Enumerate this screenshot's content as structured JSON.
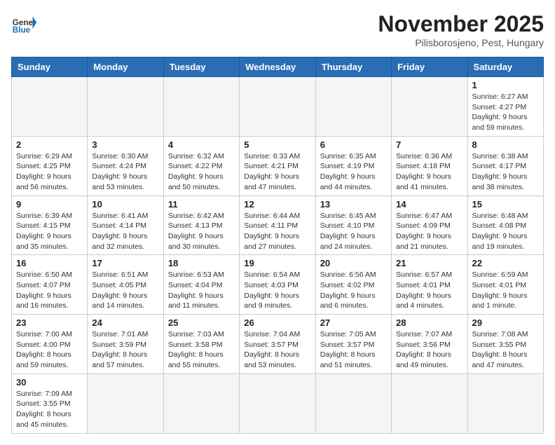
{
  "header": {
    "logo_general": "General",
    "logo_blue": "Blue",
    "month": "November 2025",
    "location": "Pilisborosjeno, Pest, Hungary"
  },
  "weekdays": [
    "Sunday",
    "Monday",
    "Tuesday",
    "Wednesday",
    "Thursday",
    "Friday",
    "Saturday"
  ],
  "weeks": [
    [
      {
        "day": "",
        "info": ""
      },
      {
        "day": "",
        "info": ""
      },
      {
        "day": "",
        "info": ""
      },
      {
        "day": "",
        "info": ""
      },
      {
        "day": "",
        "info": ""
      },
      {
        "day": "",
        "info": ""
      },
      {
        "day": "1",
        "info": "Sunrise: 6:27 AM\nSunset: 4:27 PM\nDaylight: 9 hours\nand 59 minutes."
      }
    ],
    [
      {
        "day": "2",
        "info": "Sunrise: 6:29 AM\nSunset: 4:25 PM\nDaylight: 9 hours\nand 56 minutes."
      },
      {
        "day": "3",
        "info": "Sunrise: 6:30 AM\nSunset: 4:24 PM\nDaylight: 9 hours\nand 53 minutes."
      },
      {
        "day": "4",
        "info": "Sunrise: 6:32 AM\nSunset: 4:22 PM\nDaylight: 9 hours\nand 50 minutes."
      },
      {
        "day": "5",
        "info": "Sunrise: 6:33 AM\nSunset: 4:21 PM\nDaylight: 9 hours\nand 47 minutes."
      },
      {
        "day": "6",
        "info": "Sunrise: 6:35 AM\nSunset: 4:19 PM\nDaylight: 9 hours\nand 44 minutes."
      },
      {
        "day": "7",
        "info": "Sunrise: 6:36 AM\nSunset: 4:18 PM\nDaylight: 9 hours\nand 41 minutes."
      },
      {
        "day": "8",
        "info": "Sunrise: 6:38 AM\nSunset: 4:17 PM\nDaylight: 9 hours\nand 38 minutes."
      }
    ],
    [
      {
        "day": "9",
        "info": "Sunrise: 6:39 AM\nSunset: 4:15 PM\nDaylight: 9 hours\nand 35 minutes."
      },
      {
        "day": "10",
        "info": "Sunrise: 6:41 AM\nSunset: 4:14 PM\nDaylight: 9 hours\nand 32 minutes."
      },
      {
        "day": "11",
        "info": "Sunrise: 6:42 AM\nSunset: 4:13 PM\nDaylight: 9 hours\nand 30 minutes."
      },
      {
        "day": "12",
        "info": "Sunrise: 6:44 AM\nSunset: 4:11 PM\nDaylight: 9 hours\nand 27 minutes."
      },
      {
        "day": "13",
        "info": "Sunrise: 6:45 AM\nSunset: 4:10 PM\nDaylight: 9 hours\nand 24 minutes."
      },
      {
        "day": "14",
        "info": "Sunrise: 6:47 AM\nSunset: 4:09 PM\nDaylight: 9 hours\nand 21 minutes."
      },
      {
        "day": "15",
        "info": "Sunrise: 6:48 AM\nSunset: 4:08 PM\nDaylight: 9 hours\nand 19 minutes."
      }
    ],
    [
      {
        "day": "16",
        "info": "Sunrise: 6:50 AM\nSunset: 4:07 PM\nDaylight: 9 hours\nand 16 minutes."
      },
      {
        "day": "17",
        "info": "Sunrise: 6:51 AM\nSunset: 4:05 PM\nDaylight: 9 hours\nand 14 minutes."
      },
      {
        "day": "18",
        "info": "Sunrise: 6:53 AM\nSunset: 4:04 PM\nDaylight: 9 hours\nand 11 minutes."
      },
      {
        "day": "19",
        "info": "Sunrise: 6:54 AM\nSunset: 4:03 PM\nDaylight: 9 hours\nand 9 minutes."
      },
      {
        "day": "20",
        "info": "Sunrise: 6:56 AM\nSunset: 4:02 PM\nDaylight: 9 hours\nand 6 minutes."
      },
      {
        "day": "21",
        "info": "Sunrise: 6:57 AM\nSunset: 4:01 PM\nDaylight: 9 hours\nand 4 minutes."
      },
      {
        "day": "22",
        "info": "Sunrise: 6:59 AM\nSunset: 4:01 PM\nDaylight: 9 hours\nand 1 minute."
      }
    ],
    [
      {
        "day": "23",
        "info": "Sunrise: 7:00 AM\nSunset: 4:00 PM\nDaylight: 8 hours\nand 59 minutes."
      },
      {
        "day": "24",
        "info": "Sunrise: 7:01 AM\nSunset: 3:59 PM\nDaylight: 8 hours\nand 57 minutes."
      },
      {
        "day": "25",
        "info": "Sunrise: 7:03 AM\nSunset: 3:58 PM\nDaylight: 8 hours\nand 55 minutes."
      },
      {
        "day": "26",
        "info": "Sunrise: 7:04 AM\nSunset: 3:57 PM\nDaylight: 8 hours\nand 53 minutes."
      },
      {
        "day": "27",
        "info": "Sunrise: 7:05 AM\nSunset: 3:57 PM\nDaylight: 8 hours\nand 51 minutes."
      },
      {
        "day": "28",
        "info": "Sunrise: 7:07 AM\nSunset: 3:56 PM\nDaylight: 8 hours\nand 49 minutes."
      },
      {
        "day": "29",
        "info": "Sunrise: 7:08 AM\nSunset: 3:55 PM\nDaylight: 8 hours\nand 47 minutes."
      }
    ],
    [
      {
        "day": "30",
        "info": "Sunrise: 7:09 AM\nSunset: 3:55 PM\nDaylight: 8 hours\nand 45 minutes."
      },
      {
        "day": "",
        "info": ""
      },
      {
        "day": "",
        "info": ""
      },
      {
        "day": "",
        "info": ""
      },
      {
        "day": "",
        "info": ""
      },
      {
        "day": "",
        "info": ""
      },
      {
        "day": "",
        "info": ""
      }
    ]
  ]
}
